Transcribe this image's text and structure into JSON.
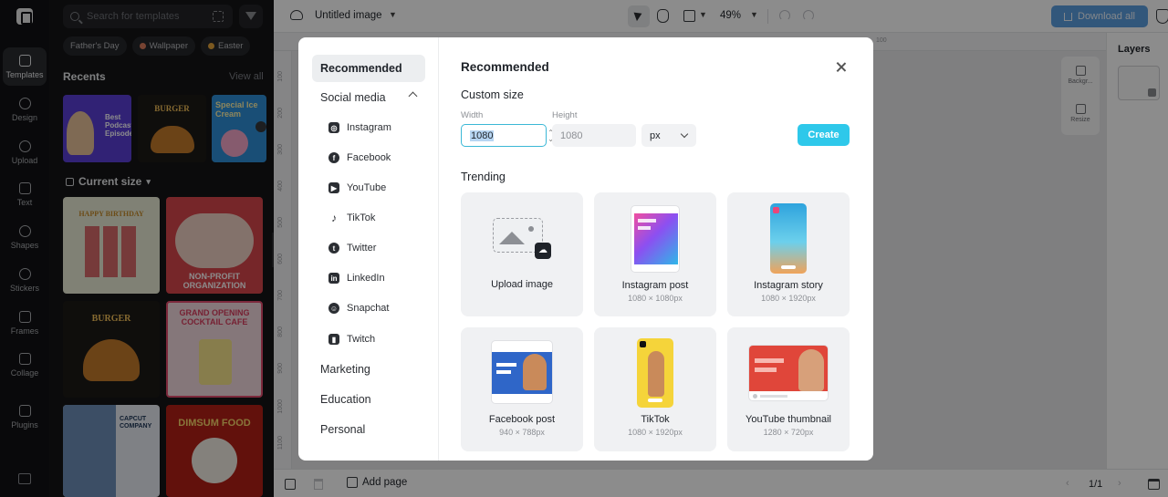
{
  "rail": {
    "items": [
      {
        "label": "Templates"
      },
      {
        "label": "Design"
      },
      {
        "label": "Upload"
      },
      {
        "label": "Text"
      },
      {
        "label": "Shapes"
      },
      {
        "label": "Stickers"
      },
      {
        "label": "Frames"
      },
      {
        "label": "Collage"
      },
      {
        "label": "Plugins"
      }
    ]
  },
  "templates_panel": {
    "search_placeholder": "Search for templates",
    "chips": [
      "Father's Day",
      "Wallpaper",
      "Easter"
    ],
    "recents_label": "Recents",
    "view_all": "View all",
    "current_size_label": "Current size",
    "recent_thumbs": [
      {
        "title": "Best Podcast Episode",
        "color": "#5a3fd6"
      },
      {
        "title": "BURGER",
        "color": "#1d1a16"
      },
      {
        "title": "Special Ice Cream",
        "color": "#2e8fd8"
      }
    ],
    "grid_thumbs": [
      {
        "title": "HAPPY BIRTHDAY",
        "color": "#e9ecd6"
      },
      {
        "title": "NON-PROFIT ORGANIZATION",
        "color": "#d7454b"
      },
      {
        "title": "BURGER",
        "color": "#1d1a16"
      },
      {
        "title": "GRAND OPENING COCKTAIL CAFE",
        "color": "#f3d9de"
      },
      {
        "title": "CAPCUT COMPANY",
        "color": "#e8ecf2"
      },
      {
        "title": "DIMSUM FOOD",
        "color": "#b31f17"
      }
    ]
  },
  "topbar": {
    "doc_title": "Untitled image",
    "zoom": "49%",
    "download_label": "Download all"
  },
  "layers": {
    "title": "Layers"
  },
  "side_tools": [
    {
      "label": "Backgr..."
    },
    {
      "label": "Resize"
    }
  ],
  "ruler": {
    "top_label": "100",
    "left_labels": [
      "100",
      "200",
      "300",
      "400",
      "500",
      "600",
      "700",
      "800",
      "900",
      "1000",
      "1100"
    ]
  },
  "bottombar": {
    "add_page": "Add page",
    "pager": "1/1"
  },
  "modal": {
    "nav": {
      "recommended": "Recommended",
      "social_media": "Social media",
      "social_items": [
        "Instagram",
        "Facebook",
        "YouTube",
        "TikTok",
        "Twitter",
        "LinkedIn",
        "Snapchat",
        "Twitch"
      ],
      "marketing": "Marketing",
      "education": "Education",
      "personal": "Personal"
    },
    "title": "Recommended",
    "custom_size": "Custom size",
    "width_label": "Width",
    "height_label": "Height",
    "width_value": "1080",
    "height_value": "1080",
    "unit": "px",
    "create_label": "Create",
    "trending_label": "Trending",
    "cards": [
      {
        "name": "Upload image",
        "size": ""
      },
      {
        "name": "Instagram post",
        "size": "1080 × 1080px"
      },
      {
        "name": "Instagram story",
        "size": "1080 × 1920px"
      },
      {
        "name": "Facebook post",
        "size": "940 × 788px"
      },
      {
        "name": "TikTok",
        "size": "1080 × 1920px"
      },
      {
        "name": "YouTube thumbnail",
        "size": "1280 × 720px"
      }
    ]
  },
  "colors": {
    "accent": "#2ec8ea",
    "download_button": "#5c9fe0",
    "focus_ring": "#3bb8d6"
  }
}
